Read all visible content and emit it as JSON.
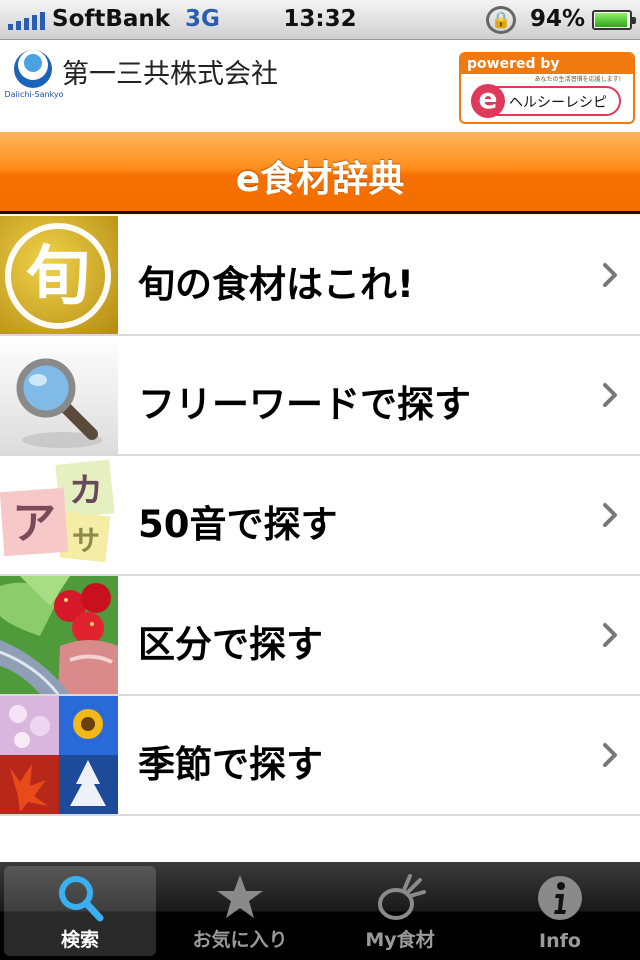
{
  "status_bar": {
    "carrier": "SoftBank",
    "network": "3G",
    "time": "13:32",
    "battery_percent": "94%",
    "battery_level": 0.94,
    "signal_bars": 5
  },
  "header": {
    "company_name": "第一三共株式会社",
    "company_logo_text": "Daiichi-Sankyo",
    "powered_by": "powered by",
    "powered_sub": "あなたの生活習慣を応援します!",
    "powered_brand_letter": "e",
    "powered_brand_name": "ヘルシーレシピ"
  },
  "title": "e食材辞典",
  "menu": [
    {
      "label": "旬の食材はこれ!",
      "thumb_text": "旬",
      "icon": "shun-seasonal-icon"
    },
    {
      "label": "フリーワードで探す",
      "icon": "magnifier-icon"
    },
    {
      "label": "50音で探す",
      "icon": "kana-cards-icon",
      "thumb_text": [
        "ア",
        "カ",
        "サ"
      ]
    },
    {
      "label": "区分で探す",
      "icon": "food-category-icon"
    },
    {
      "label": "季節で探す",
      "icon": "seasons-icon"
    }
  ],
  "tabs": [
    {
      "label": "検索",
      "icon": "search-icon",
      "active": true
    },
    {
      "label": "お気に入り",
      "icon": "star-icon",
      "active": false
    },
    {
      "label": "My食材",
      "icon": "vegetable-icon",
      "active": false
    },
    {
      "label": "Info",
      "icon": "info-icon",
      "active": false
    }
  ],
  "colors": {
    "title_bar": "#f57000",
    "status_network": "#2a5db0",
    "powered_orange": "#f07a10",
    "brand_pink": "#e03a5a"
  }
}
